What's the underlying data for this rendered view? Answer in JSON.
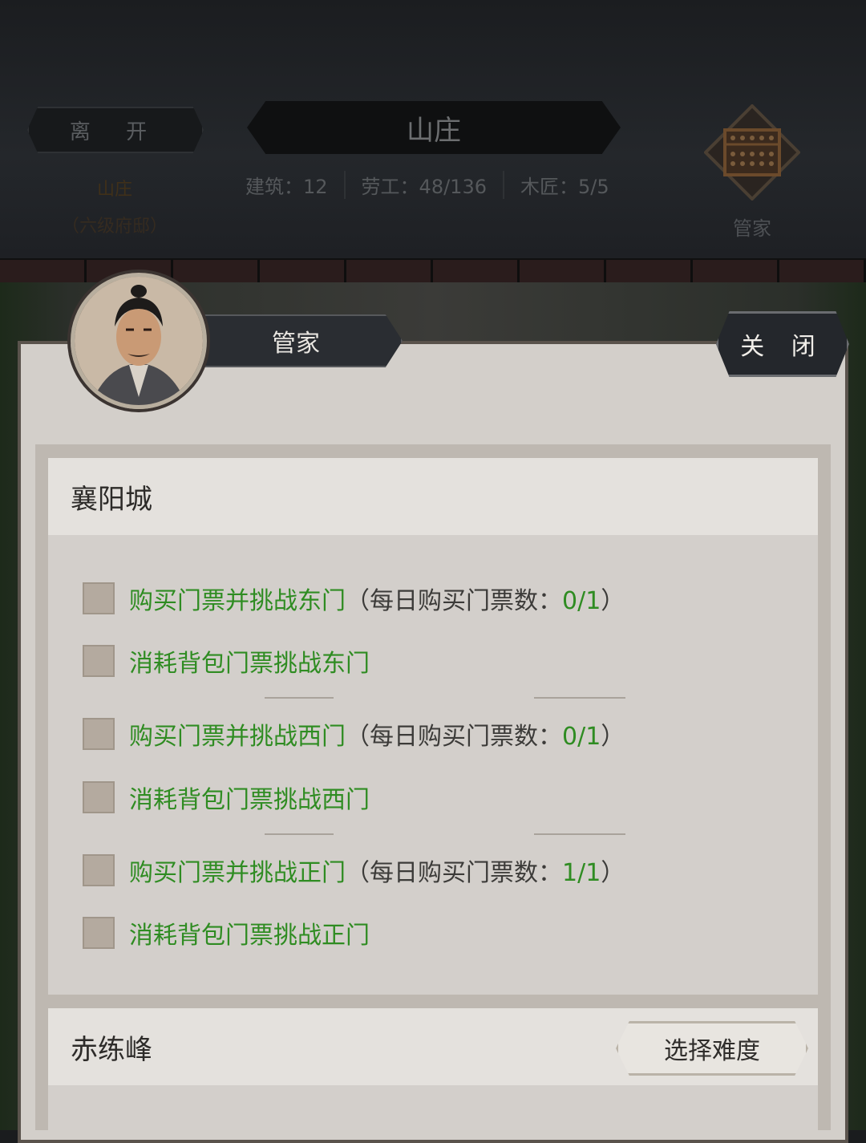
{
  "header": {
    "leave_label": "离 开",
    "title": "山庄",
    "location_name": "山庄",
    "location_level": "（六级府邸）",
    "stats": [
      {
        "label": "建筑：",
        "value": "12"
      },
      {
        "label": "劳工：",
        "value": "48/136"
      },
      {
        "label": "木匠：",
        "value": "5/5"
      }
    ],
    "steward_label": "管家",
    "steward_icon": "abacus-icon"
  },
  "dialog": {
    "name": "管家",
    "close_label": "关 闭",
    "sections": [
      {
        "title": "襄阳城",
        "options": [
          {
            "text": "购买门票并挑战东门",
            "note_prefix": "（每日购买门票数：",
            "count": "0/1",
            "note_suffix": "）",
            "checked": false
          },
          {
            "text": "消耗背包门票挑战东门",
            "checked": false
          },
          {
            "text": "购买门票并挑战西门",
            "note_prefix": "（每日购买门票数：",
            "count": "0/1",
            "note_suffix": "）",
            "checked": false
          },
          {
            "text": "消耗背包门票挑战西门",
            "checked": false
          },
          {
            "text": "购买门票并挑战正门",
            "note_prefix": "（每日购买门票数：",
            "count": "1/1",
            "note_suffix": "）",
            "checked": false
          },
          {
            "text": "消耗背包门票挑战正门",
            "checked": false
          }
        ]
      },
      {
        "title": "赤练峰",
        "action_label": "选择难度"
      }
    ]
  },
  "colors": {
    "option_green": "#2f8c22",
    "panel_bg": "#d3cfca",
    "checkbox": "#b4aa9f"
  }
}
